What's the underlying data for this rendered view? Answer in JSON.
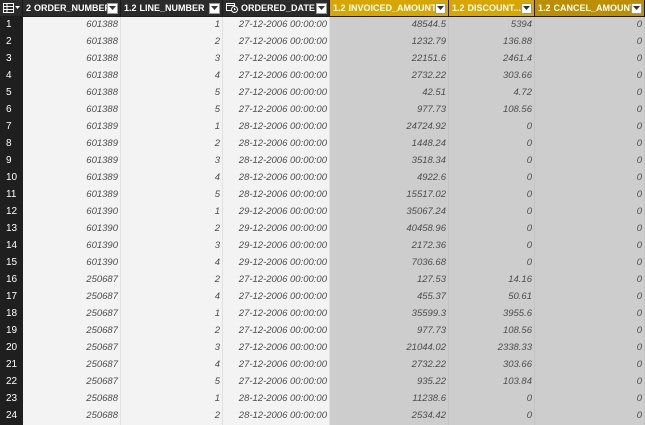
{
  "columns": [
    {
      "type_glyph": "2",
      "label": "ORDER_NUMBER"
    },
    {
      "type_glyph": "1.2",
      "label": "LINE_NUMBER"
    },
    {
      "type_glyph": "calendar-clock",
      "label": "ORDERED_DATE"
    },
    {
      "type_glyph": "1.2",
      "label": "INVOICED_AMOUNT"
    },
    {
      "type_glyph": "1.2",
      "label": "DISCOUNT..."
    },
    {
      "type_glyph": "1.2",
      "label": "CANCEL_AMOUNT"
    }
  ],
  "rows": [
    {
      "idx": "1",
      "order": "601388",
      "line": "1",
      "date": "27-12-2006 00:00:00",
      "invoiced": "48544.5",
      "discount": "5394",
      "cancel": "0"
    },
    {
      "idx": "2",
      "order": "601388",
      "line": "2",
      "date": "27-12-2006 00:00:00",
      "invoiced": "1232.79",
      "discount": "136.88",
      "cancel": "0"
    },
    {
      "idx": "3",
      "order": "601388",
      "line": "3",
      "date": "27-12-2006 00:00:00",
      "invoiced": "22151.6",
      "discount": "2461.4",
      "cancel": "0"
    },
    {
      "idx": "4",
      "order": "601388",
      "line": "4",
      "date": "27-12-2006 00:00:00",
      "invoiced": "2732.22",
      "discount": "303.66",
      "cancel": "0"
    },
    {
      "idx": "5",
      "order": "601388",
      "line": "5",
      "date": "27-12-2006 00:00:00",
      "invoiced": "42.51",
      "discount": "4.72",
      "cancel": "0"
    },
    {
      "idx": "6",
      "order": "601388",
      "line": "5",
      "date": "27-12-2006 00:00:00",
      "invoiced": "977.73",
      "discount": "108.56",
      "cancel": "0"
    },
    {
      "idx": "7",
      "order": "601389",
      "line": "1",
      "date": "28-12-2006 00:00:00",
      "invoiced": "24724.92",
      "discount": "0",
      "cancel": "0"
    },
    {
      "idx": "8",
      "order": "601389",
      "line": "2",
      "date": "28-12-2006 00:00:00",
      "invoiced": "1448.24",
      "discount": "0",
      "cancel": "0"
    },
    {
      "idx": "9",
      "order": "601389",
      "line": "3",
      "date": "28-12-2006 00:00:00",
      "invoiced": "3518.34",
      "discount": "0",
      "cancel": "0"
    },
    {
      "idx": "10",
      "order": "601389",
      "line": "4",
      "date": "28-12-2006 00:00:00",
      "invoiced": "4922.6",
      "discount": "0",
      "cancel": "0"
    },
    {
      "idx": "11",
      "order": "601389",
      "line": "5",
      "date": "28-12-2006 00:00:00",
      "invoiced": "15517.02",
      "discount": "0",
      "cancel": "0"
    },
    {
      "idx": "12",
      "order": "601390",
      "line": "1",
      "date": "29-12-2006 00:00:00",
      "invoiced": "35067.24",
      "discount": "0",
      "cancel": "0"
    },
    {
      "idx": "13",
      "order": "601390",
      "line": "2",
      "date": "29-12-2006 00:00:00",
      "invoiced": "40458.96",
      "discount": "0",
      "cancel": "0"
    },
    {
      "idx": "14",
      "order": "601390",
      "line": "3",
      "date": "29-12-2006 00:00:00",
      "invoiced": "2172.36",
      "discount": "0",
      "cancel": "0"
    },
    {
      "idx": "15",
      "order": "601390",
      "line": "4",
      "date": "29-12-2006 00:00:00",
      "invoiced": "7036.68",
      "discount": "0",
      "cancel": "0"
    },
    {
      "idx": "16",
      "order": "250687",
      "line": "2",
      "date": "27-12-2006 00:00:00",
      "invoiced": "127.53",
      "discount": "14.16",
      "cancel": "0"
    },
    {
      "idx": "17",
      "order": "250687",
      "line": "4",
      "date": "27-12-2006 00:00:00",
      "invoiced": "455.37",
      "discount": "50.61",
      "cancel": "0"
    },
    {
      "idx": "18",
      "order": "250687",
      "line": "1",
      "date": "27-12-2006 00:00:00",
      "invoiced": "35599.3",
      "discount": "3955.6",
      "cancel": "0"
    },
    {
      "idx": "19",
      "order": "250687",
      "line": "2",
      "date": "27-12-2006 00:00:00",
      "invoiced": "977.73",
      "discount": "108.56",
      "cancel": "0"
    },
    {
      "idx": "20",
      "order": "250687",
      "line": "3",
      "date": "27-12-2006 00:00:00",
      "invoiced": "21044.02",
      "discount": "2338.33",
      "cancel": "0"
    },
    {
      "idx": "21",
      "order": "250687",
      "line": "4",
      "date": "27-12-2006 00:00:00",
      "invoiced": "2732.22",
      "discount": "303.66",
      "cancel": "0"
    },
    {
      "idx": "22",
      "order": "250687",
      "line": "5",
      "date": "27-12-2006 00:00:00",
      "invoiced": "935.22",
      "discount": "103.84",
      "cancel": "0"
    },
    {
      "idx": "23",
      "order": "250688",
      "line": "1",
      "date": "28-12-2006 00:00:00",
      "invoiced": "11238.6",
      "discount": "0",
      "cancel": "0"
    },
    {
      "idx": "24",
      "order": "250688",
      "line": "2",
      "date": "28-12-2006 00:00:00",
      "invoiced": "2534.42",
      "discount": "0",
      "cancel": "0"
    }
  ],
  "colors": {
    "header_dark": "#2b2b2b",
    "header_yellow": "#d9a600",
    "header_yellow_dark": "#bd8e00",
    "index_bg": "#1f1f1f",
    "selected_cols_bg": "#cdcdcd",
    "cell_bg": "#f3f3f3"
  }
}
